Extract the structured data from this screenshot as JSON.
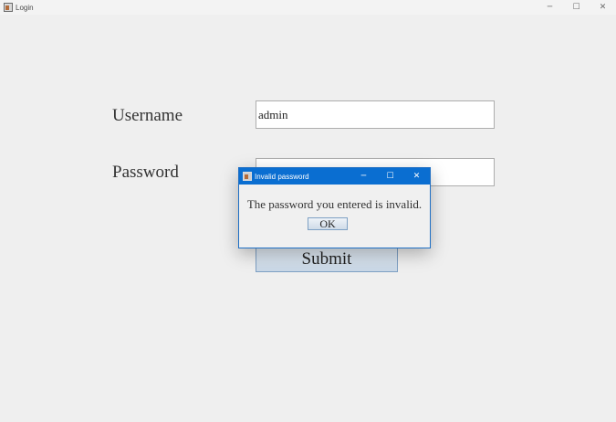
{
  "window": {
    "title": "Login",
    "controls": {
      "minimize": "─",
      "maximize": "☐",
      "close": "✕"
    }
  },
  "form": {
    "username_label": "Username",
    "username_value": "admin",
    "password_label": "Password",
    "password_value": "",
    "submit_label": "Submit"
  },
  "dialog": {
    "title": "Invalid password",
    "message": "The password you entered is invalid.",
    "ok_label": "OK",
    "controls": {
      "minimize": "─",
      "maximize": "☐",
      "close": "✕"
    }
  },
  "colors": {
    "dialog_titlebar": "#0a6ed1",
    "window_background": "#efefef"
  }
}
